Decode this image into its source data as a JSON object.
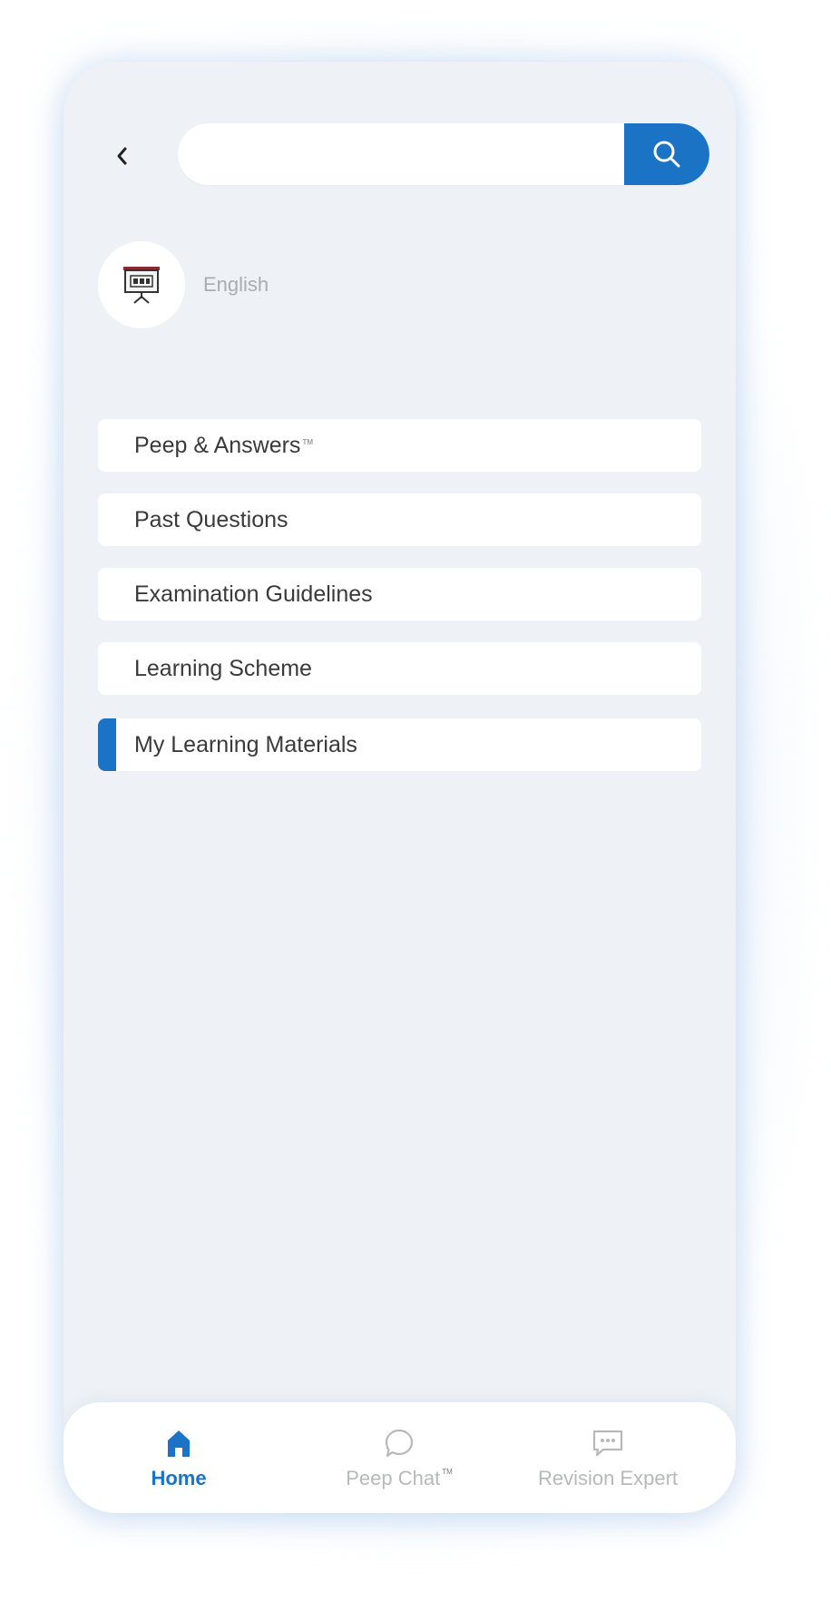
{
  "search": {
    "value": "",
    "placeholder": ""
  },
  "subject": {
    "label": "English"
  },
  "menu": {
    "items": [
      {
        "label": "Peep & Answers",
        "tm": "TM"
      },
      {
        "label": "Past Questions"
      },
      {
        "label": "Examination Guidelines"
      },
      {
        "label": "Learning Scheme"
      },
      {
        "label": "My Learning Materials"
      }
    ],
    "active_index": 4
  },
  "nav": {
    "home": {
      "label": "Home"
    },
    "peep_chat": {
      "label": "Peep Chat",
      "tm": "TM"
    },
    "revision_expert": {
      "label": "Revision Expert"
    }
  },
  "colors": {
    "accent": "#1a73c4",
    "background": "#eef2f6",
    "muted_text": "#b6b8bc"
  },
  "icons": {
    "back": "chevron-left-icon",
    "search": "search-icon",
    "subject": "presentation-board-icon",
    "home": "home-icon",
    "peep_chat": "chat-bubble-icon",
    "revision_expert": "message-dots-icon"
  }
}
